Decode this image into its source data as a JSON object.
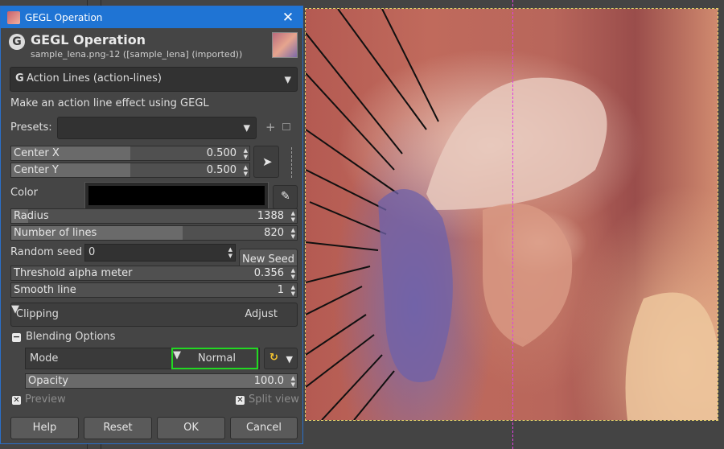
{
  "dialog": {
    "title": "GEGL Operation",
    "header_title": "GEGL Operation",
    "header_subtitle": "sample_lena.png-12 ([sample_lena] (imported))",
    "operation": "Action Lines (action-lines)",
    "description": "Make an action line effect using GEGL",
    "presets_label": "Presets:",
    "presets_value": "",
    "presets_add": "+",
    "center_x": {
      "label": "Center X",
      "value": "0.500",
      "fraction": 0.5
    },
    "center_y": {
      "label": "Center Y",
      "value": "0.500",
      "fraction": 0.5
    },
    "color_label": "Color",
    "color_value": "#000000",
    "radius": {
      "label": "Radius",
      "value": "1388",
      "fraction": 0.06
    },
    "number_of_lines": {
      "label": "Number of lines",
      "value": "820",
      "fraction": 0.6
    },
    "random_seed": {
      "label": "Random seed",
      "value": "0",
      "button": "New Seed"
    },
    "threshold": {
      "label": "Threshold alpha meter",
      "value": "0.356",
      "fraction": 0
    },
    "smooth_line": {
      "label": "Smooth line",
      "value": "1",
      "fraction": 0
    },
    "clipping": {
      "label": "Clipping",
      "value": "Adjust"
    },
    "blending_title": "Blending Options",
    "blending_toggle": "−",
    "mode": {
      "label": "Mode",
      "value": "Normal"
    },
    "opacity": {
      "label": "Opacity",
      "value": "100.0",
      "fraction": 1.0
    },
    "preview_label": "Preview",
    "splitview_label": "Split view",
    "buttons": {
      "help": "Help",
      "reset": "Reset",
      "ok": "OK",
      "cancel": "Cancel"
    }
  },
  "icons": {
    "close": "close-icon",
    "gegl": "G",
    "pointer": "pointer-icon",
    "eyedropper": "eyedropper-icon"
  },
  "colors": {
    "titlebar": "#1f74d4",
    "mode_highlight": "#22d822",
    "accent_yellow": "#f2c230"
  }
}
